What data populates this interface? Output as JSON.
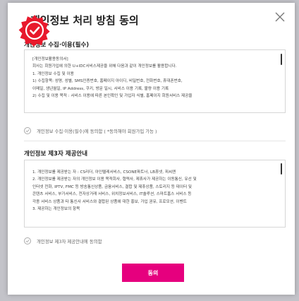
{
  "dialog": {
    "title": "개인정보 처리 방침 동의",
    "close_icon": "close-icon",
    "badge_icon": "check-seal-icon"
  },
  "section1": {
    "title": "개인정보 수집·이용(필수)",
    "lines": [
      "[개인정보활용동의서]",
      "회사는 회원가입에 의한 U+IDC서비스제공을 위해 다음과 같이 개인정보를 활용합니다.",
      "1. 개인정보 수집 및 이용",
      "1) 수집항목: 성명, 성별, SMS인증번호, 홈페이지 아이디, 비밀번호, 전화번호, 휴대폰번호,",
      " 이메일, 생년월일, IP Address, 쿠키, 방문 일시, 서비스 이용 기록, 불량 이용 기록",
      "2) 수집 및 이용 목적 : 서비스 이용에 따른 본인확인 및 가입자 식별, 홈페이지 회원서비스 제공을"
    ],
    "agree_label": "개인정보 수집·이용(필수)에 동의함 ( *동의해야 회원가입 가능 )"
  },
  "section2": {
    "title": "개인정보 제3자 제공안내",
    "lines": [
      "1. 개인정보를 제공받는 자 : CS리더, 아인텔레서비스, CSONE파트너, LB휴넷, 피씨엔",
      "2. 개인정보를 제공받는 자의 개인정보 이용 목적회사, 협력사, 제휴사가 제공하는 이동통신, 유선 및",
      "인터넷 전화, IPTV, FMC 등 방송통신상품, 금융서비스, 결합 및 제휴상품, 스토리지 등 데이터 및",
      "콘텐츠 서비스, 부가서비스, 전자상거래 서비스, 위치정보서비스, IT솔루션, 스마트홈스 서비스 등",
      "각종 서비스 상품과 타 통신사 서비스와 결합된 상품에 대한 홍보, 가입 권유, 프로모션, 이벤트",
      "3. 제공하는 개인정보의 항목"
    ],
    "agree_label": "개인정보 제3자 제공안내에 동의함"
  },
  "submit_label": "동의",
  "colors": {
    "accent": "#e6007e",
    "badge": "#e8192c"
  }
}
